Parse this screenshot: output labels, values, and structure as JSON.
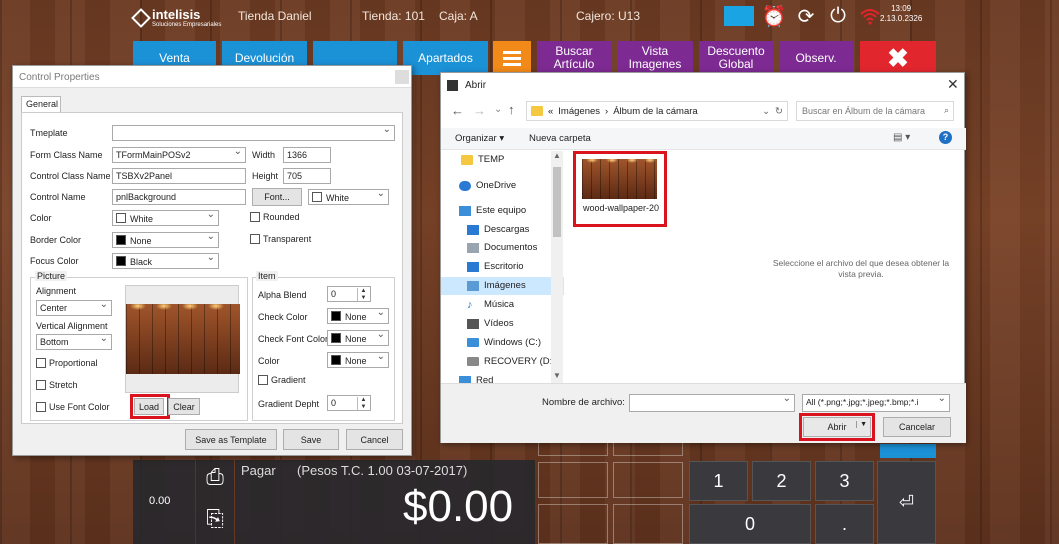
{
  "header": {
    "logo_text": "intelisis",
    "logo_sub": "Soluciones Empresariales",
    "store_name": "Tienda Daniel",
    "store": "Tienda: 101",
    "register": "Caja: A",
    "cashier": "Cajero: U13",
    "time": "13:09",
    "version": "2.13.0.2326"
  },
  "main_buttons": {
    "venta": "Venta",
    "devolucion": "Devolución",
    "apartados": "Apartados",
    "buscar_articulo": "Buscar Artículo",
    "vista_imagenes": "Vista Imagenes",
    "descuento_global": "Descuento Global",
    "observ": "Observ.",
    "close": "✖"
  },
  "pos": {
    "pay_label": "Pagar",
    "pay_info": "(Pesos T.C. 1.00 03-07-2017)",
    "amount": "$0.00",
    "subtotal": "0.00",
    "keys": [
      "1",
      "2",
      "3",
      "0",
      ".",
      "⏎"
    ]
  },
  "control_props": {
    "title": "Control Properties",
    "tab": "General",
    "tmeplate_label": "Tmeplate",
    "tmeplate_value": "",
    "form_class_label": "Form Class Name",
    "form_class_value": "TFormMainPOSv2",
    "control_class_label": "Control Class Name",
    "control_class_value": "TSBXv2Panel",
    "control_name_label": "Control Name",
    "control_name_value": "pnlBackground",
    "width_label": "Width",
    "width_value": "1366",
    "height_label": "Height",
    "height_value": "705",
    "font_button": "Font...",
    "font_color": "White",
    "color_label": "Color",
    "color_value": "White",
    "border_color_label": "Border Color",
    "border_color_value": "None",
    "focus_color_label": "Focus Color",
    "focus_color_value": "Black",
    "rounded": "Rounded",
    "transparent": "Transparent",
    "picture_group": "Picture",
    "alignment_label": "Alignment",
    "alignment_value": "Center",
    "valign_label": "Vertical Alignment",
    "valign_value": "Bottom",
    "proportional": "Proportional",
    "stretch": "Stretch",
    "use_font_color": "Use Font Color",
    "load_button": "Load",
    "clear_button": "Clear",
    "item_group": "Item",
    "alpha_blend_label": "Alpha Blend",
    "alpha_blend_value": "0",
    "check_color_label": "Check Color",
    "check_color_value": "None",
    "check_font_color_label": "Check Font Color",
    "check_font_color_value": "None",
    "item_color_label": "Color",
    "item_color_value": "None",
    "gradient": "Gradient",
    "gradient_depth_label": "Gradient Depht",
    "gradient_depth_value": "0",
    "save_template": "Save as Template",
    "save": "Save",
    "cancel": "Cancel"
  },
  "open_dialog": {
    "title": "Abrir",
    "path_root": "«",
    "path_1": "Imágenes",
    "path_sep": "›",
    "path_2": "Álbum de la cámara",
    "search_placeholder": "Buscar en Álbum de la cámara",
    "organize": "Organizar ▾",
    "new_folder": "Nueva carpeta",
    "sidebar": [
      "TEMP",
      "OneDrive",
      "Este equipo",
      "Descargas",
      "Documentos",
      "Escritorio",
      "Imágenes",
      "Música",
      "Vídeos",
      "Windows (C:)",
      "RECOVERY (D:)",
      "Red"
    ],
    "file_name": "wood-wallpaper-20",
    "preview_text": "Seleccione el archivo del que desea obtener la vista previa.",
    "filename_label": "Nombre de archivo:",
    "filename_value": "",
    "filter": "All (*.png;*.jpg;*.jpeg;*.bmp;*.i",
    "open_button": "Abrir",
    "cancel_button": "Cancelar"
  }
}
